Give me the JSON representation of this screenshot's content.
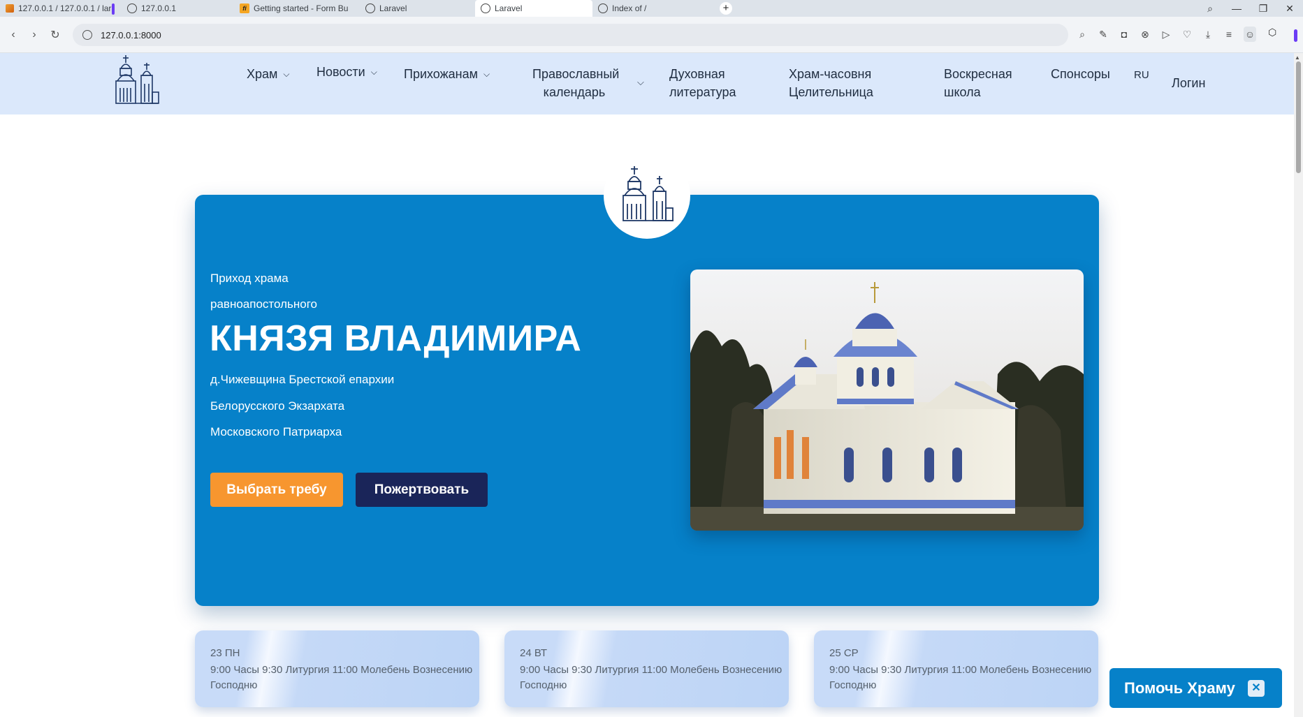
{
  "browser": {
    "tabs": [
      {
        "title": "127.0.0.1 / 127.0.0.1 / lara",
        "icon": "phpmyadmin-icon"
      },
      {
        "title": "127.0.0.1",
        "icon": "globe-icon"
      },
      {
        "title": "Getting started - Form Bu",
        "icon": "formbuilder-icon"
      },
      {
        "title": "Laravel",
        "icon": "globe-icon"
      },
      {
        "title": "Laravel",
        "icon": "globe-icon"
      },
      {
        "title": "Index of /",
        "icon": "globe-icon"
      }
    ],
    "active_tab": 4,
    "url": "127.0.0.1:8000",
    "newtab_symbol": "+",
    "window_controls": {
      "search": "⌕",
      "minimize": "—",
      "restore": "❐",
      "close": "✕"
    }
  },
  "header": {
    "nav": {
      "temple": "Храм",
      "news": "Новости",
      "parishioners": "Прихожанам",
      "calendar_line1": "Православный",
      "calendar_line2": "календарь",
      "literature_line1": "Духовная",
      "literature_line2": "литература",
      "chapel_line1": "Храм-часовня",
      "chapel_line2": "Целительница",
      "school_line1": "Воскресная",
      "school_line2": "школа",
      "sponsors": "Спонсоры",
      "lang": "RU",
      "login": "Логин"
    }
  },
  "hero": {
    "line1": "Приход храма",
    "line2": "равноапостольного",
    "title": "КНЯЗЯ ВЛАДИМИРА",
    "line3": "д.Чижевщина Брестской епархии",
    "line4": "Белорусского Экзархата",
    "line5": "Московского Патриарха",
    "btn_treba": "Выбрать требу",
    "btn_donate": "Пожертвовать",
    "colors": {
      "panel": "#0681c9",
      "treba": "#f7962f",
      "donate": "#1a2559"
    }
  },
  "schedule": [
    {
      "date": "23 ПН",
      "services": "9:00 Часы 9:30 Литургия 11:00 Молебень Вознесению Господню"
    },
    {
      "date": "24 ВТ",
      "services": "9:00 Часы 9:30 Литургия 11:00 Молебень Вознесению Господню"
    },
    {
      "date": "25 СР",
      "services": "9:00 Часы 9:30 Литургия 11:00 Молебень Вознесению Господню"
    }
  ],
  "help_widget": {
    "label": "Помочь Храму",
    "close": "✕"
  }
}
